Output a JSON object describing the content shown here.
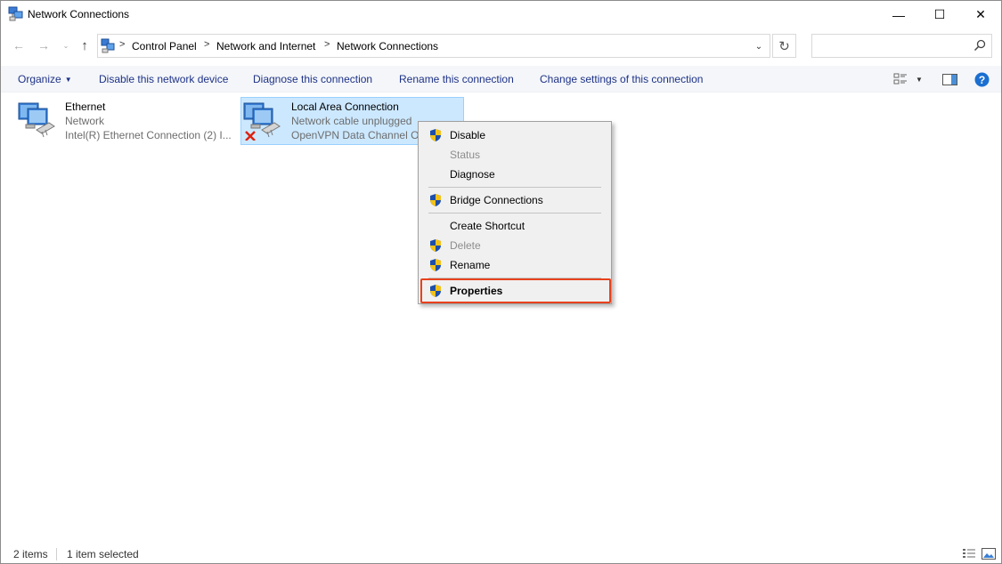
{
  "window": {
    "title": "Network Connections",
    "minimize_glyph": "—",
    "maximize_glyph": "☐",
    "close_glyph": "✕"
  },
  "nav": {
    "back_glyph": "←",
    "forward_glyph": "→",
    "recent_glyph": "⌄",
    "up_glyph": "↑",
    "breadcrumbs": [
      {
        "label": "Control Panel"
      },
      {
        "label": "Network and Internet"
      },
      {
        "label": "Network Connections"
      }
    ],
    "separator": ">",
    "dropdown_glyph": "⌄",
    "refresh_glyph": "↻",
    "search_placeholder": ""
  },
  "commands": {
    "organize": "Organize",
    "organize_caret": "▼",
    "disable": "Disable this network device",
    "diagnose": "Diagnose this connection",
    "rename": "Rename this connection",
    "change_settings": "Change settings of this connection",
    "view_caret": "▼",
    "help_glyph": "?"
  },
  "items": [
    {
      "name": "Ethernet",
      "status": "Network",
      "device": "Intel(R) Ethernet Connection (2) I...",
      "selected": false,
      "disconnected": false
    },
    {
      "name": "Local Area Connection",
      "status": "Network cable unplugged",
      "device": "OpenVPN Data Channel Offload",
      "selected": true,
      "disconnected": true
    }
  ],
  "context_menu": {
    "items": [
      {
        "label": "Disable",
        "shield": true,
        "disabled": false
      },
      {
        "label": "Status",
        "shield": false,
        "disabled": true
      },
      {
        "label": "Diagnose",
        "shield": false,
        "disabled": false
      },
      {
        "label": "Bridge Connections",
        "shield": true,
        "disabled": false
      },
      {
        "label": "Create Shortcut",
        "shield": false,
        "disabled": false
      },
      {
        "label": "Delete",
        "shield": true,
        "disabled": true
      },
      {
        "label": "Rename",
        "shield": true,
        "disabled": false
      },
      {
        "label": "Properties",
        "shield": true,
        "disabled": false,
        "bold": true,
        "highlighted": true
      }
    ]
  },
  "status": {
    "item_count": "2 items",
    "selection": "1 item selected"
  },
  "colors": {
    "link_blue": "#1e3287",
    "selection_bg": "#cce8ff",
    "highlight_border": "#e8411c",
    "help_blue": "#1a6fd1"
  }
}
